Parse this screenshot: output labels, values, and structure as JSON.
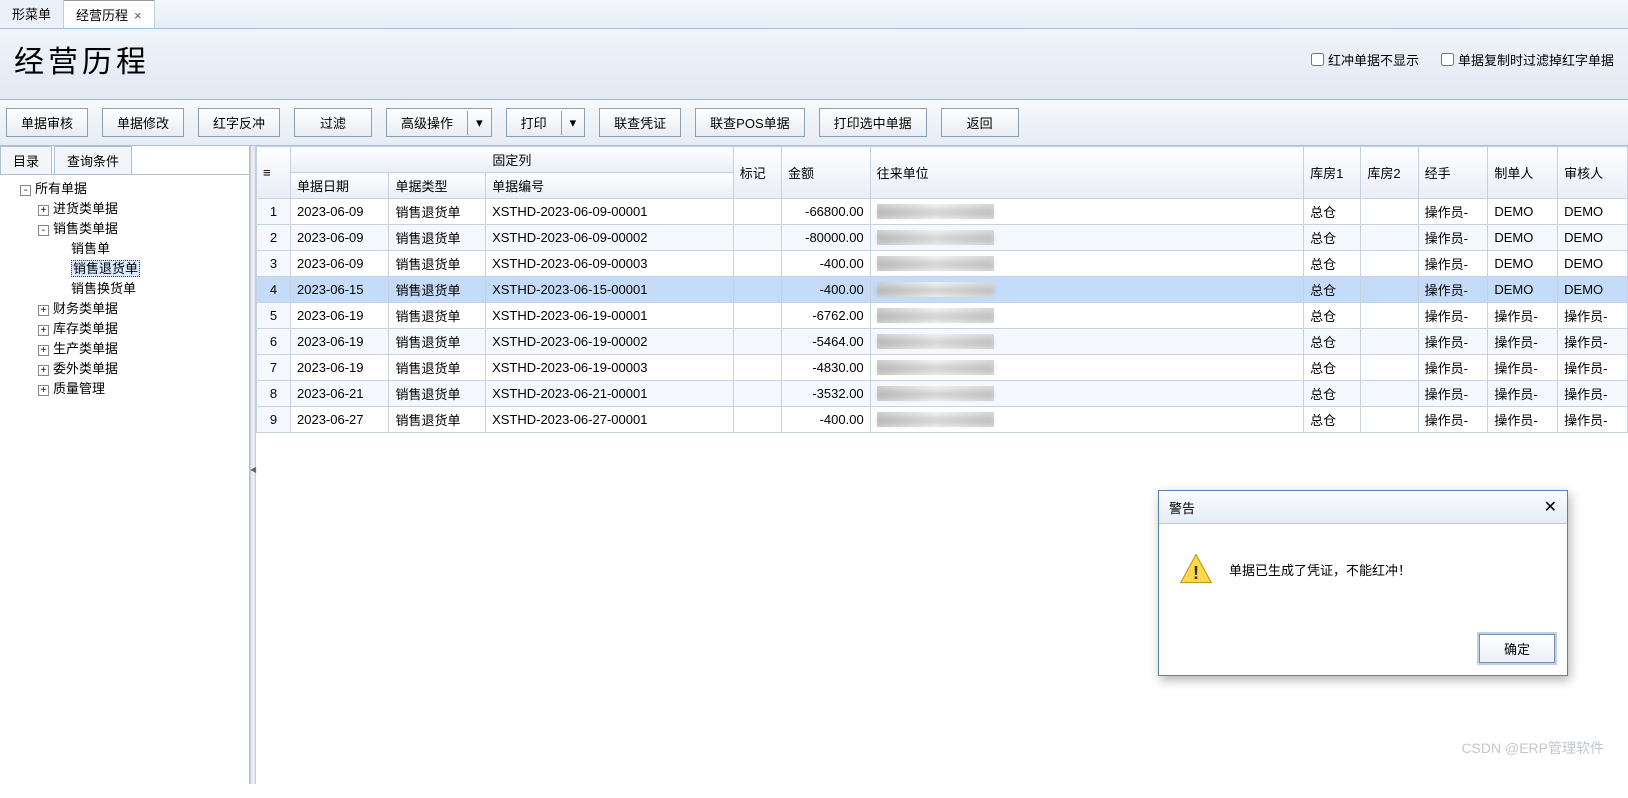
{
  "tabs": [
    {
      "label": "形菜单",
      "closable": false
    },
    {
      "label": "经营历程",
      "closable": true
    }
  ],
  "page_title": "经营历程",
  "checkboxes": {
    "hide_red": "红冲单据不显示",
    "filter_red_on_copy": "单据复制时过滤掉红字单据"
  },
  "toolbar": {
    "audit": "单据审核",
    "modify": "单据修改",
    "red_reverse": "红字反冲",
    "filter": "过滤",
    "advanced": "高级操作",
    "print": "打印",
    "lookup_voucher": "联查凭证",
    "lookup_pos": "联查POS单据",
    "print_selected": "打印选中单据",
    "back": "返回"
  },
  "left_tabs": {
    "catalog": "目录",
    "query": "查询条件"
  },
  "tree": {
    "root": "所有单据",
    "purchase": "进货类单据",
    "sales": "销售类单据",
    "sale": "销售单",
    "sale_return": "销售退货单",
    "sale_exchange": "销售换货单",
    "finance": "财务类单据",
    "inventory": "库存类单据",
    "production": "生产类单据",
    "outsource": "委外类单据",
    "quality": "质量管理"
  },
  "grid": {
    "fixed_group": "固定列",
    "cols": {
      "date": "单据日期",
      "type": "单据类型",
      "code": "单据编号",
      "mark": "标记",
      "amount": "金额",
      "party": "往来单位",
      "wh1": "库房1",
      "wh2": "库房2",
      "handler": "经手",
      "maker": "制单人",
      "auditor": "审核人"
    },
    "rows": [
      {
        "n": 1,
        "date": "2023-06-09",
        "type": "销售退货单",
        "code": "XSTHD-2023-06-09-00001",
        "mark": "",
        "amount": "-66800.00",
        "party": "",
        "wh1": "总仓",
        "wh2": "",
        "handler": "操作员-",
        "maker": "DEMO",
        "auditor": "DEMO"
      },
      {
        "n": 2,
        "date": "2023-06-09",
        "type": "销售退货单",
        "code": "XSTHD-2023-06-09-00002",
        "mark": "",
        "amount": "-80000.00",
        "party": "",
        "wh1": "总仓",
        "wh2": "",
        "handler": "操作员-",
        "maker": "DEMO",
        "auditor": "DEMO"
      },
      {
        "n": 3,
        "date": "2023-06-09",
        "type": "销售退货单",
        "code": "XSTHD-2023-06-09-00003",
        "mark": "",
        "amount": "-400.00",
        "party": "",
        "wh1": "总仓",
        "wh2": "",
        "handler": "操作员-",
        "maker": "DEMO",
        "auditor": "DEMO"
      },
      {
        "n": 4,
        "date": "2023-06-15",
        "type": "销售退货单",
        "code": "XSTHD-2023-06-15-00001",
        "mark": "",
        "amount": "-400.00",
        "party": "",
        "wh1": "总仓",
        "wh2": "",
        "handler": "操作员-",
        "maker": "DEMO",
        "auditor": "DEMO",
        "selected": true
      },
      {
        "n": 5,
        "date": "2023-06-19",
        "type": "销售退货单",
        "code": "XSTHD-2023-06-19-00001",
        "mark": "",
        "amount": "-6762.00",
        "party": "",
        "wh1": "总仓",
        "wh2": "",
        "handler": "操作员-",
        "maker": "操作员-",
        "auditor": "操作员-"
      },
      {
        "n": 6,
        "date": "2023-06-19",
        "type": "销售退货单",
        "code": "XSTHD-2023-06-19-00002",
        "mark": "",
        "amount": "-5464.00",
        "party": "",
        "wh1": "总仓",
        "wh2": "",
        "handler": "操作员-",
        "maker": "操作员-",
        "auditor": "操作员-"
      },
      {
        "n": 7,
        "date": "2023-06-19",
        "type": "销售退货单",
        "code": "XSTHD-2023-06-19-00003",
        "mark": "",
        "amount": "-4830.00",
        "party": "",
        "wh1": "总仓",
        "wh2": "",
        "handler": "操作员-",
        "maker": "操作员-",
        "auditor": "操作员-"
      },
      {
        "n": 8,
        "date": "2023-06-21",
        "type": "销售退货单",
        "code": "XSTHD-2023-06-21-00001",
        "mark": "",
        "amount": "-3532.00",
        "party": "",
        "wh1": "总仓",
        "wh2": "",
        "handler": "操作员-",
        "maker": "操作员-",
        "auditor": "操作员-"
      },
      {
        "n": 9,
        "date": "2023-06-27",
        "type": "销售退货单",
        "code": "XSTHD-2023-06-27-00001",
        "mark": "",
        "amount": "-400.00",
        "party": "",
        "wh1": "总仓",
        "wh2": "",
        "handler": "操作员-",
        "maker": "操作员-",
        "auditor": "操作员-"
      }
    ]
  },
  "dialog": {
    "title": "警告",
    "message": "单据已生成了凭证，不能红冲！",
    "ok": "确定"
  },
  "watermark": "CSDN @ERP管理软件"
}
